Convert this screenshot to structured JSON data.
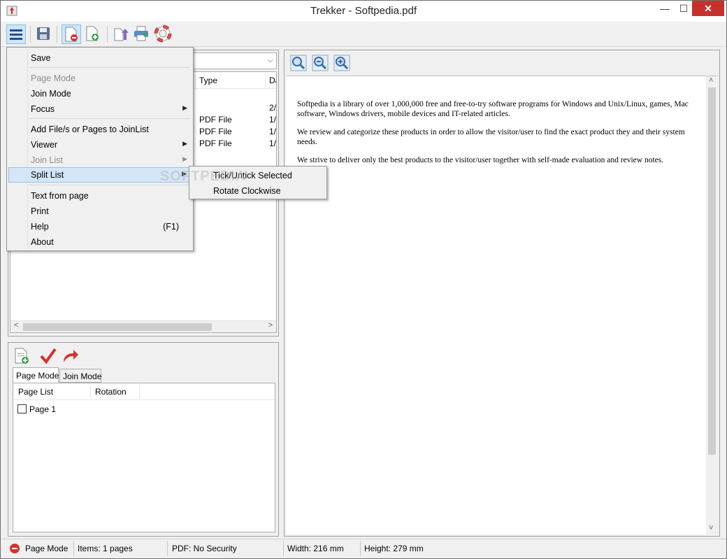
{
  "window": {
    "title": "Trekker - Softpedia.pdf",
    "minimize": "—",
    "maximize": "☐",
    "close": "✕"
  },
  "toolbar": {
    "icons": [
      "menu-icon",
      "save-icon",
      "page-mode-icon",
      "add-page-icon",
      "upload-icon",
      "print-icon",
      "help-icon"
    ]
  },
  "filelist": {
    "columns": {
      "type": "Type",
      "date": "Da"
    },
    "rows": [
      {
        "type": "",
        "date": "2/"
      },
      {
        "type": "PDF File",
        "date": "1/"
      },
      {
        "type": "PDF File",
        "date": "1/"
      },
      {
        "type": "PDF File",
        "date": "1/"
      },
      {
        "type": "PDF File",
        "date": "1/"
      }
    ],
    "scroll_left": "<",
    "scroll_right": ">"
  },
  "menu": {
    "save": "Save",
    "page_mode": "Page Mode",
    "join_mode": "Join Mode",
    "focus": "Focus",
    "add_files": "Add File/s or Pages to JoinList",
    "viewer": "Viewer",
    "join_list": "Join List",
    "split_list": "Split List",
    "text_from_page": "Text from page",
    "print": "Print",
    "help": "Help",
    "help_accel": "(F1)",
    "about": "About",
    "submenu_arrow": "▶"
  },
  "submenu": {
    "tick_untick": "Tick/Untick Selected",
    "rotate": "Rotate Clockwise"
  },
  "pagepanel": {
    "tabs": {
      "page_mode": "Page Mode",
      "join_mode": "Join Mode"
    },
    "columns": {
      "page_list": "Page List",
      "rotation": "Rotation"
    },
    "items": [
      {
        "label": "Page 1",
        "checked": false
      }
    ]
  },
  "viewer": {
    "paragraphs": [
      "Softpedia is a library of over 1,000,000 free and free-to-try software programs for Windows and Unix/Linux, games, Mac software, Windows drivers, mobile devices and IT-related articles.",
      "We review and categorize these products in order to allow the visitor/user to find the exact product they and their system needs.",
      "We strive to deliver only the best products to the visitor/user together with self-made evaluation and review notes."
    ],
    "scroll_up": "˄",
    "scroll_down": "˅"
  },
  "statusbar": {
    "mode": "Page Mode",
    "items": "Items: 1 pages",
    "security": "PDF: No Security",
    "width": "Width: 216 mm",
    "height": "Height: 279 mm"
  },
  "watermark": "SOFTPEDIA",
  "colors": {
    "selection": "#3399ff",
    "highlight": "#d5e6f8",
    "close_button": "#c7312c",
    "status_icon": "#d9302c"
  }
}
